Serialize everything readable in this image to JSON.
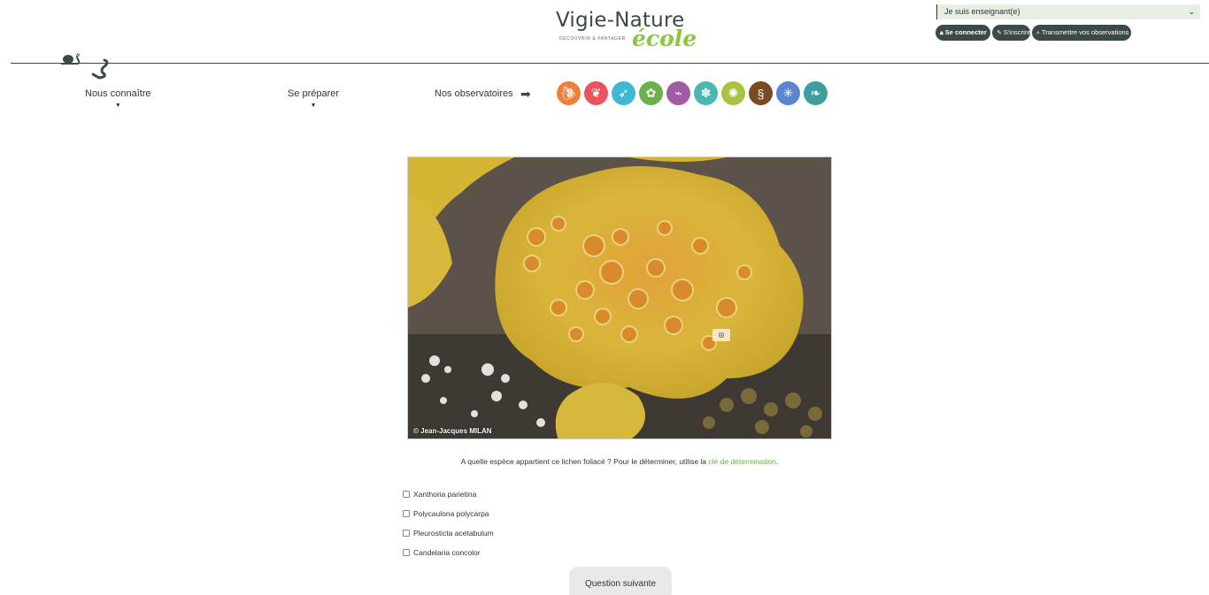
{
  "header": {
    "logo": {
      "main": "Vigie-Nature",
      "tagline": "DÉCOUVRIR & PARTAGER",
      "sub": "école"
    },
    "role_select": {
      "value": "Je suis enseignant(e)"
    },
    "auth": [
      {
        "label": "Se connecter",
        "icon": "lock-icon"
      },
      {
        "label": "S'inscrire",
        "icon": "pencil-icon"
      },
      {
        "label": "Transmettre vos observations",
        "icon": "search-icon"
      }
    ]
  },
  "nav": {
    "items": [
      {
        "label": "Nous connaître"
      },
      {
        "label": "Se préparer"
      },
      {
        "label": "Nos observatoires"
      }
    ],
    "observatories": [
      {
        "icon": "snail-icon",
        "color": "#f07f3c"
      },
      {
        "icon": "butterfly-icon",
        "color": "#e9535d"
      },
      {
        "icon": "bird-icon",
        "color": "#3fb8d6"
      },
      {
        "icon": "plant-icon",
        "color": "#6ab04c"
      },
      {
        "icon": "bat-icon",
        "color": "#a15aa6"
      },
      {
        "icon": "flower-icon",
        "color": "#49b9b0"
      },
      {
        "icon": "insect-icon",
        "color": "#a9c23f"
      },
      {
        "icon": "earthworm-icon",
        "color": "#7a4a24"
      },
      {
        "icon": "coral-icon",
        "color": "#5b86cf"
      },
      {
        "icon": "seaweed-icon",
        "color": "#3d9e9e"
      }
    ]
  },
  "photo": {
    "credit": "© Jean-Jacques MILAN"
  },
  "quiz": {
    "question_before": "A quelle espèce appartient ce lichen foliacé ? Pour le déterminer, utilise la ",
    "question_link": "clé de détermination",
    "question_after": ".",
    "answers": [
      {
        "label": "Xanthoria parietina"
      },
      {
        "label": "Polycaulona polycarpa"
      },
      {
        "label": "Pleurosticta acetabulum"
      },
      {
        "label": "Candelaria concolor"
      }
    ],
    "next_label": "Question suivante"
  }
}
